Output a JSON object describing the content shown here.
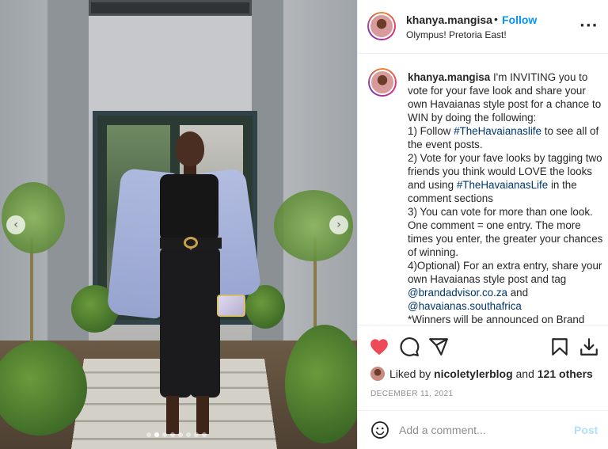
{
  "post": {
    "username": "khanya.mangisa",
    "separator": "•",
    "follow_label": "Follow",
    "location": "Olympus! Pretoria East!",
    "more_icon": "more-horizontal-icon"
  },
  "caption": {
    "username": "khanya.mangisa",
    "intro": "I'm INVITING you to vote for your fave look and share your own Havaianas style post for a chance to WIN by doing the following:",
    "step1_pre": "1) Follow",
    "step1_tag": "#TheHavaianaslife",
    "step1_post": "to see all of the event posts.",
    "step2_pre": "2) Vote for your fave looks by tagging two friends you think would LOVE the looks and using",
    "step2_tag": "#TheHavaianasLife",
    "step2_post": "in the comment sections",
    "step3": "3) You can vote for more than one look. One comment = one entry. The more times you enter, the greater your chances of winning.",
    "step4": "4)Optional) For an extra entry, share your own Havaianas style post and tag",
    "mention1": "@brandadvisor.co.za",
    "and": "and",
    "mention2": "@havaianas.southafrica",
    "winners": "*Winners will be announced on Brand"
  },
  "actions": {
    "like_icon": "heart-filled-icon",
    "comment_icon": "comment-icon",
    "share_icon": "share-icon",
    "save_icon": "bookmark-icon",
    "download_icon": "download-icon"
  },
  "likes": {
    "prefix": "Liked by",
    "user": "nicoletylerblog",
    "middle": "and",
    "others": "121 others"
  },
  "date": "DECEMBER 11, 2021",
  "comment": {
    "placeholder": "Add a comment...",
    "post_label": "Post"
  },
  "carousel": {
    "prev_glyph": "‹",
    "next_glyph": "›",
    "slide_count": 8,
    "active_slide": 1
  },
  "colors": {
    "accent": "#0095f6",
    "like_red": "#ed4956",
    "link": "#00376b",
    "muted": "#8e8e8e",
    "post_disabled": "#b2dffc"
  }
}
